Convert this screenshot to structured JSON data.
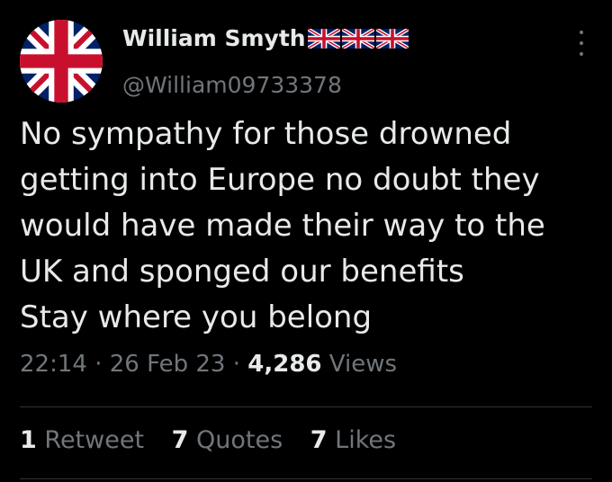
{
  "colors": {
    "background": "#000000",
    "text_primary": "#e7e9ea",
    "text_secondary": "#71767b",
    "divider": "#2f3336",
    "flag_blue": "#012169",
    "flag_red": "#C8102E"
  },
  "author": {
    "display_name": "William Smyth",
    "flag_icons": [
      "uk-flag-icon",
      "uk-flag-icon",
      "uk-flag-icon"
    ],
    "handle": "@William09733378",
    "avatar_icon": "uk-flag-avatar"
  },
  "tweet": {
    "lines": [
      "No sympathy for those drowned",
      "getting into Europe no doubt they",
      "would have made their way to the",
      "UK and sponged our benefits",
      "Stay where you belong"
    ],
    "time": "22:14",
    "date": "26 Feb 23",
    "separator": "·",
    "views_count": "4,286",
    "views_label": "Views"
  },
  "stats": {
    "retweets_count": "1",
    "retweets_label": "Retweet",
    "quotes_count": "7",
    "quotes_label": "Quotes",
    "likes_count": "7",
    "likes_label": "Likes"
  },
  "more_icon": "more-vertical-icon"
}
